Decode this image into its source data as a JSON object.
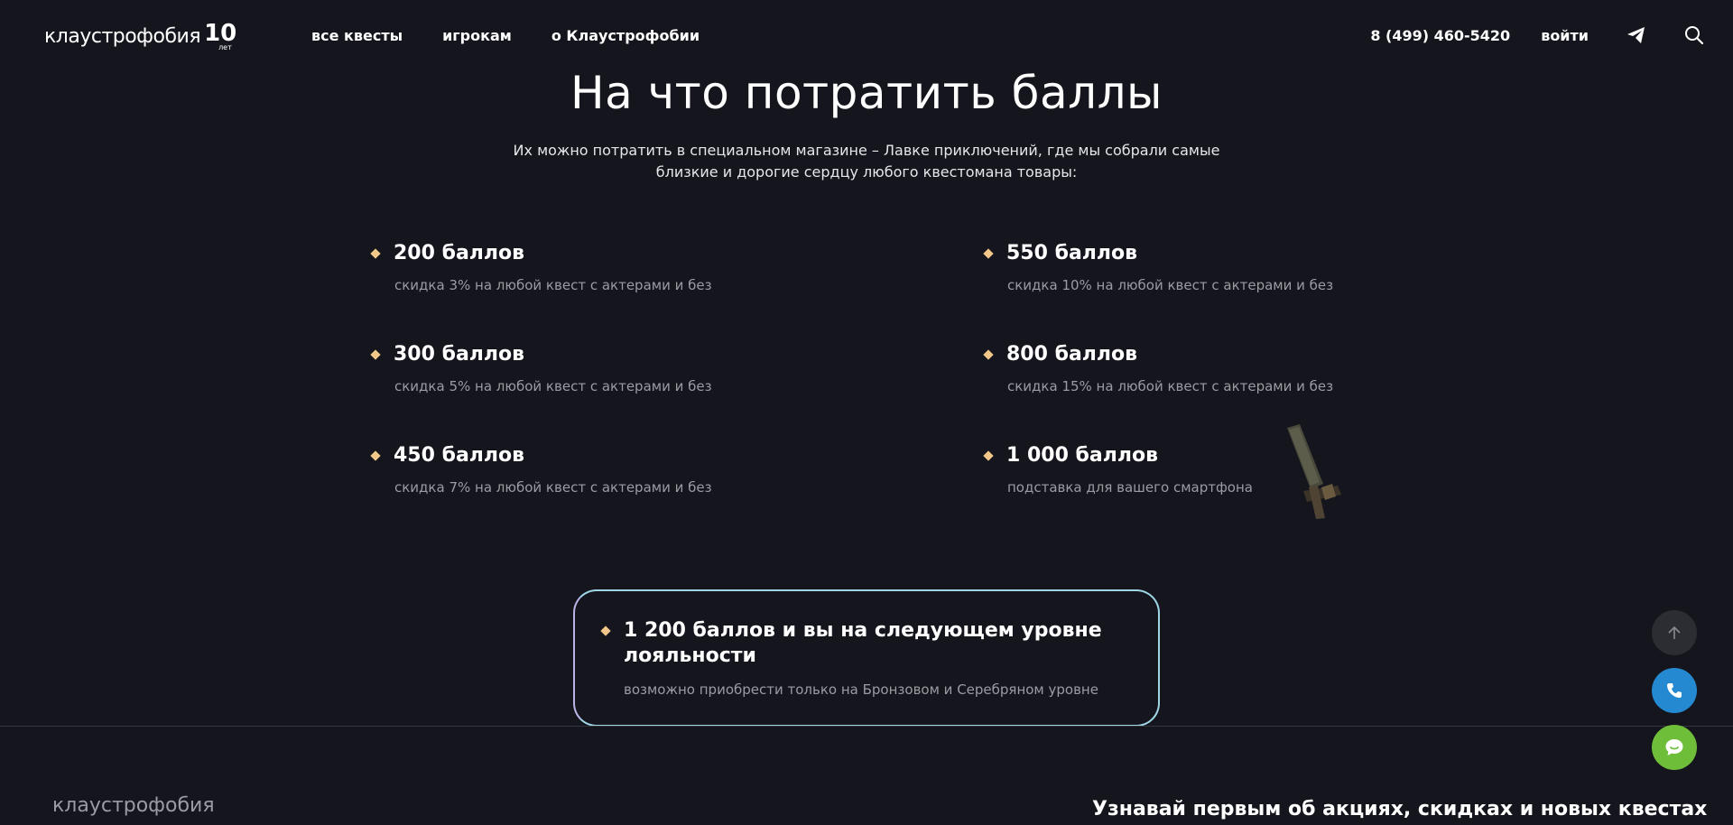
{
  "header": {
    "logo_text": "клаустрофобия",
    "logo_anniversary": "10",
    "logo_years": "лет",
    "nav": [
      {
        "label": "все квесты"
      },
      {
        "label": "игрокам"
      },
      {
        "label": "о Клаустрофобии"
      }
    ],
    "phone": "8 (499) 460-5420",
    "login": "войти",
    "icons": [
      "telegram-icon",
      "search-icon"
    ]
  },
  "section": {
    "title": "На что потратить баллы",
    "subtitle": "Их можно потратить в специальном магазине – Лавке приключений, где мы собрали самые близкие и дорогие сердцу любого квестомана товары:"
  },
  "rewards": [
    {
      "points": "200 баллов",
      "desc": "скидка 3% на любой квест с актерами и без"
    },
    {
      "points": "300 баллов",
      "desc": "скидка 5% на любой квест с актерами и без"
    },
    {
      "points": "450 баллов",
      "desc": "скидка 7% на любой квест с актерами и без"
    },
    {
      "points": "550 баллов",
      "desc": "скидка 10% на любой квест с актерами и без"
    },
    {
      "points": "800 баллов",
      "desc": "скидка 15% на любой квест с актерами и без"
    },
    {
      "points": "1 000 баллов",
      "desc": "подставка для вашего смартфона"
    }
  ],
  "loyalty": {
    "points": "1 200 баллов и вы на следующем уровне лояльности",
    "desc": "возможно приобрести только на Бронзовом и Серебряном уровне"
  },
  "footer": {
    "logo_text": "клаустрофобия",
    "heading": "Узнавай первым об акциях, скидках и новых квестах"
  },
  "colors": {
    "background": "#15161d",
    "bullet": "#f2c88a",
    "phone_fab": "#2589d2",
    "chat_fab": "#6fbe3a",
    "up_fab": "#2c2d33"
  },
  "floating_buttons": [
    "arrow-up-icon",
    "phone-icon",
    "chat-icon"
  ]
}
